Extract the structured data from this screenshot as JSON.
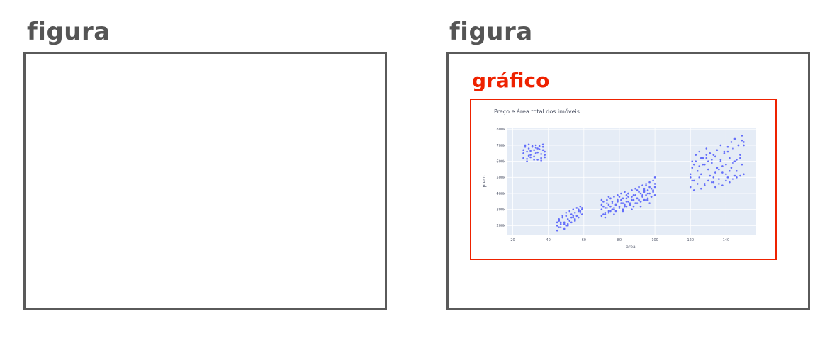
{
  "left_panel": {
    "label": "figura"
  },
  "right_panel": {
    "label": "figura",
    "inner_label": "gráfico"
  },
  "colors": {
    "figura_label": "#555555",
    "frame_border": "#5a5a5a",
    "grafico_label": "#ee2200",
    "plot_background": "#e5ecf6",
    "marker": "#636efa"
  },
  "chart_data": {
    "type": "scatter",
    "title": "Preço e área total dos imóveis.",
    "xlabel": "area",
    "ylabel": "preco",
    "xlim": [
      17,
      157
    ],
    "ylim": [
      140000,
      810000
    ],
    "x_ticks": [
      20,
      40,
      60,
      80,
      100,
      120,
      140
    ],
    "x_tick_labels": [
      "20",
      "40",
      "60",
      "80",
      "100",
      "120",
      "140"
    ],
    "y_ticks": [
      200000,
      300000,
      400000,
      500000,
      600000,
      700000,
      800000
    ],
    "y_tick_labels": [
      "200k",
      "300k",
      "400k",
      "500k",
      "600k",
      "700k",
      "800k"
    ],
    "grid": true,
    "series": [
      {
        "x": [
          26,
          28,
          30,
          32,
          34,
          36,
          38,
          27,
          29,
          31,
          33,
          35,
          37,
          26,
          28,
          30,
          32,
          34,
          36,
          38,
          27,
          29,
          31,
          33,
          35,
          37,
          26,
          30,
          34,
          38,
          28,
          32,
          36,
          29,
          33,
          37
        ],
        "y": [
          650000,
          660000,
          640000,
          670000,
          655000,
          645000,
          660000,
          690000,
          680000,
          695000,
          685000,
          675000,
          690000,
          620000,
          615000,
          625000,
          630000,
          610000,
          620000,
          625000,
          700000,
          705000,
          690000,
          700000,
          695000,
          705000,
          670000,
          665000,
          680000,
          640000,
          600000,
          610000,
          605000,
          635000,
          650000,
          670000
        ]
      },
      {
        "x": [
          45,
          46,
          47,
          48,
          49,
          50,
          51,
          52,
          53,
          54,
          55,
          56,
          57,
          58,
          59,
          45,
          47,
          49,
          51,
          53,
          55,
          57,
          59,
          46,
          48,
          50,
          52,
          54,
          56,
          58,
          45,
          49,
          53,
          57,
          47,
          51,
          55,
          59,
          46,
          50,
          54,
          58
        ],
        "y": [
          200000,
          230000,
          210000,
          250000,
          220000,
          260000,
          240000,
          230000,
          270000,
          250000,
          280000,
          260000,
          290000,
          280000,
          300000,
          170000,
          190000,
          210000,
          200000,
          220000,
          240000,
          250000,
          270000,
          240000,
          260000,
          280000,
          290000,
          300000,
          310000,
          320000,
          220000,
          180000,
          250000,
          300000,
          220000,
          210000,
          230000,
          310000,
          190000,
          200000,
          260000,
          290000
        ]
      },
      {
        "x": [
          70,
          71,
          72,
          73,
          74,
          75,
          76,
          77,
          78,
          79,
          80,
          81,
          82,
          83,
          84,
          85,
          86,
          87,
          88,
          89,
          90,
          91,
          92,
          93,
          94,
          95,
          96,
          97,
          98,
          99,
          100,
          70,
          72,
          74,
          76,
          78,
          80,
          82,
          84,
          86,
          88,
          90,
          92,
          94,
          96,
          98,
          100,
          71,
          73,
          75,
          77,
          79,
          81,
          83,
          85,
          87,
          89,
          91,
          93,
          95,
          97,
          99,
          70,
          73,
          76,
          79,
          82,
          85,
          88,
          91,
          94,
          97,
          100,
          71,
          74,
          77,
          80,
          83,
          86,
          89,
          92,
          95,
          98,
          72,
          75,
          78,
          81,
          84,
          87,
          90,
          93,
          96,
          99,
          70,
          75,
          80,
          85,
          90,
          95,
          100,
          72,
          77,
          82,
          87,
          92,
          97,
          74,
          84,
          94,
          76,
          86,
          96
        ],
        "y": [
          300000,
          320000,
          280000,
          310000,
          330000,
          290000,
          340000,
          310000,
          330000,
          350000,
          320000,
          360000,
          340000,
          330000,
          370000,
          350000,
          340000,
          380000,
          360000,
          390000,
          370000,
          360000,
          400000,
          380000,
          410000,
          390000,
          420000,
          400000,
          430000,
          410000,
          440000,
          260000,
          270000,
          280000,
          300000,
          290000,
          310000,
          300000,
          320000,
          330000,
          320000,
          340000,
          350000,
          360000,
          370000,
          380000,
          390000,
          350000,
          360000,
          370000,
          380000,
          390000,
          400000,
          410000,
          400000,
          420000,
          430000,
          440000,
          450000,
          460000,
          470000,
          480000,
          330000,
          340000,
          350000,
          360000,
          370000,
          380000,
          390000,
          410000,
          420000,
          440000,
          460000,
          270000,
          290000,
          300000,
          310000,
          320000,
          330000,
          340000,
          350000,
          360000,
          380000,
          310000,
          320000,
          330000,
          340000,
          350000,
          360000,
          370000,
          390000,
          400000,
          420000,
          360000,
          370000,
          380000,
          400000,
          420000,
          450000,
          500000,
          250000,
          270000,
          290000,
          300000,
          320000,
          340000,
          380000,
          390000,
          430000,
          300000,
          330000,
          360000
        ],
        "name": ""
      },
      {
        "x": [
          120,
          121,
          122,
          123,
          124,
          125,
          126,
          127,
          128,
          129,
          130,
          131,
          132,
          133,
          134,
          135,
          136,
          137,
          138,
          139,
          140,
          141,
          142,
          143,
          144,
          145,
          146,
          147,
          148,
          149,
          150,
          120,
          122,
          124,
          126,
          128,
          130,
          132,
          134,
          136,
          138,
          140,
          142,
          144,
          146,
          148,
          150,
          121,
          123,
          125,
          127,
          129,
          131,
          133,
          135,
          137,
          139,
          141,
          143,
          145,
          147,
          149,
          120,
          124,
          128,
          132,
          136,
          140,
          144,
          148,
          122,
          126,
          130,
          134,
          138,
          142,
          146,
          150,
          121,
          125,
          129,
          133,
          137,
          141,
          145,
          149
        ],
        "y": [
          520000,
          560000,
          480000,
          600000,
          540000,
          500000,
          620000,
          580000,
          460000,
          640000,
          550000,
          510000,
          590000,
          470000,
          630000,
          560000,
          490000,
          610000,
          530000,
          650000,
          580000,
          500000,
          620000,
          560000,
          680000,
          600000,
          540000,
          700000,
          620000,
          580000,
          720000,
          440000,
          420000,
          460000,
          430000,
          450000,
          480000,
          470000,
          440000,
          460000,
          450000,
          480000,
          470000,
          490000,
          500000,
          510000,
          520000,
          600000,
          640000,
          660000,
          620000,
          680000,
          650000,
          640000,
          670000,
          700000,
          660000,
          690000,
          720000,
          740000,
          700000,
          760000,
          500000,
          540000,
          580000,
          610000,
          550000,
          520000,
          590000,
          640000,
          580000,
          520000,
          600000,
          530000,
          570000,
          540000,
          610000,
          700000,
          480000,
          570000,
          620000,
          500000,
          600000,
          660000,
          510000,
          730000
        ]
      }
    ]
  }
}
